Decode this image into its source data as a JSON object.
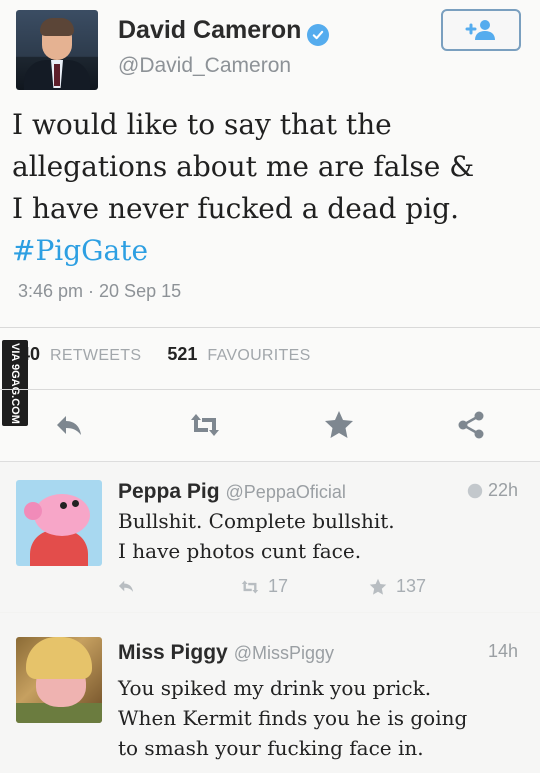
{
  "tweet": {
    "author_name": "David Cameron",
    "author_handle": "@David_Cameron",
    "follow_label": "+",
    "text_lines": [
      "I would like to say that the",
      "allegations about me are false &",
      "I have never fucked a dead pig."
    ],
    "hashtag": "#PigGate",
    "timestamp": "3:46 pm · 20 Sep 15",
    "retweets_count": "40",
    "retweets_label": "RETWEETS",
    "favourites_count": "521",
    "favourites_label": "FAVOURITES",
    "actions": [
      "reply-icon",
      "retweet-icon",
      "favorite-icon",
      "share-icon"
    ]
  },
  "watermark": "VIA 9GAG.COM",
  "replies": [
    {
      "name": "Peppa Pig",
      "handle": "@PeppaOficial",
      "time": "22h",
      "text_lines": [
        "Bullshit. Complete bullshit.",
        "I have photos cunt face."
      ],
      "retweets": "17",
      "favourites": "137"
    },
    {
      "name": "Miss Piggy",
      "handle": "@MissPiggy",
      "time": "14h",
      "text_lines": [
        "You spiked my drink you prick.",
        "When Kermit finds you he is going",
        "to smash your fucking face in."
      ]
    }
  ],
  "colors": {
    "accent": "#55acee",
    "hashtag": "#2d9fe2",
    "muted": "#8d9297"
  }
}
